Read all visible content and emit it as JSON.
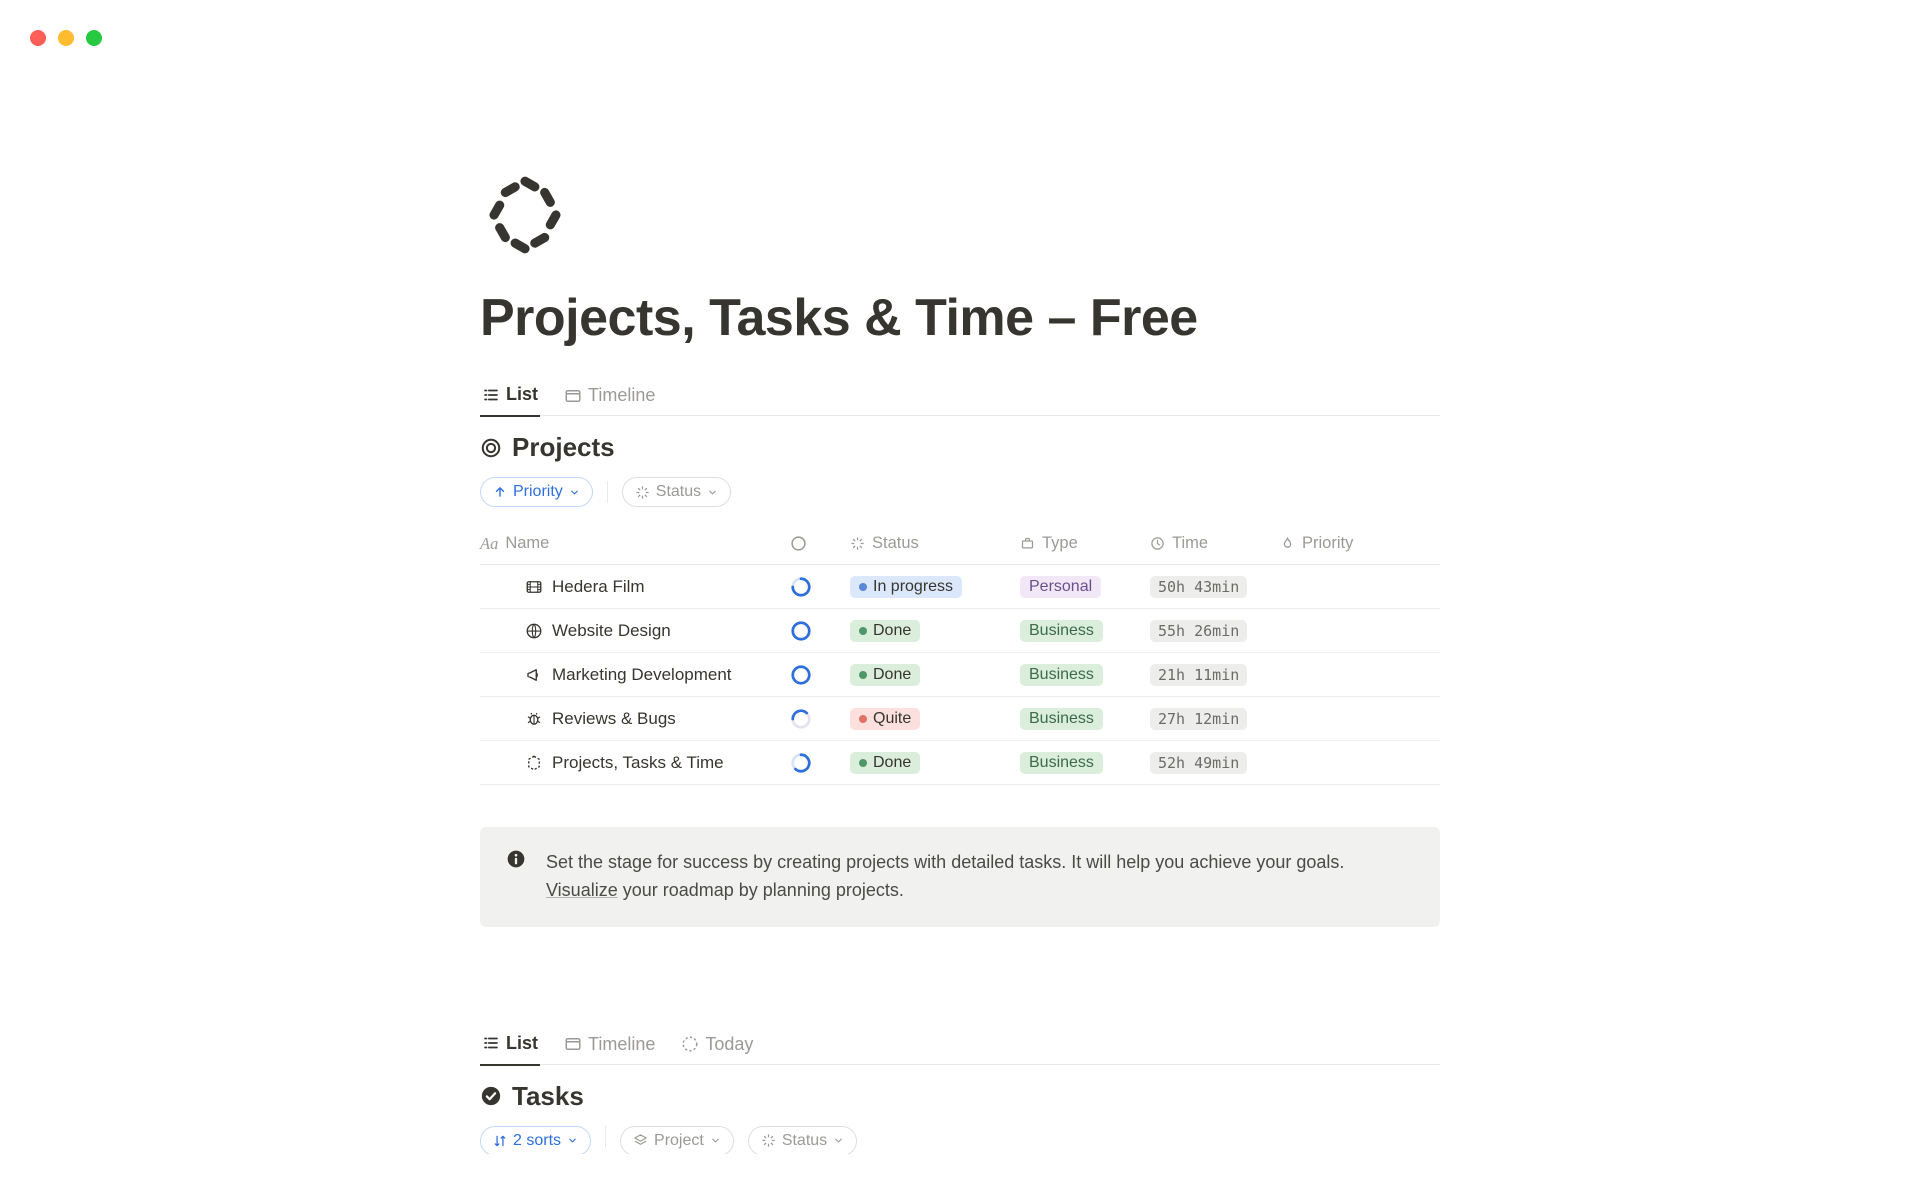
{
  "page": {
    "title": "Projects, Tasks & Time – Free"
  },
  "tabsTop": {
    "list": "List",
    "timeline": "Timeline"
  },
  "projects": {
    "heading": "Projects",
    "filters": {
      "priority": "Priority",
      "status": "Status"
    },
    "columns": {
      "name": "Name",
      "status": "Status",
      "type": "Type",
      "time": "Time",
      "priority": "Priority"
    },
    "rows": [
      {
        "name": "Hedera Film",
        "progress": 75,
        "status": "In progress",
        "statusClass": "blue",
        "type": "Personal",
        "typeClass": "personal",
        "time": "50h 43min"
      },
      {
        "name": "Website Design",
        "progress": 100,
        "status": "Done",
        "statusClass": "green",
        "type": "Business",
        "typeClass": "business",
        "time": "55h 26min"
      },
      {
        "name": "Marketing Development",
        "progress": 100,
        "status": "Done",
        "statusClass": "green",
        "type": "Business",
        "typeClass": "business",
        "time": "21h 11min"
      },
      {
        "name": "Reviews & Bugs",
        "progress": 35,
        "status": "Quite",
        "statusClass": "red",
        "type": "Business",
        "typeClass": "business",
        "time": "27h 12min"
      },
      {
        "name": "Projects, Tasks & Time",
        "progress": 85,
        "status": "Done",
        "statusClass": "green",
        "type": "Business",
        "typeClass": "business",
        "time": "52h 49min"
      }
    ]
  },
  "callout": {
    "textBefore": "Set the stage for success by creating projects with detailed tasks. It will help you achieve your goals. ",
    "link": "Visualize",
    "textAfter": " your roadmap by planning projects."
  },
  "tabsBottom": {
    "list": "List",
    "timeline": "Timeline",
    "today": "Today"
  },
  "tasks": {
    "heading": "Tasks",
    "filters": {
      "sorts": "2 sorts",
      "project": "Project",
      "status": "Status"
    }
  }
}
